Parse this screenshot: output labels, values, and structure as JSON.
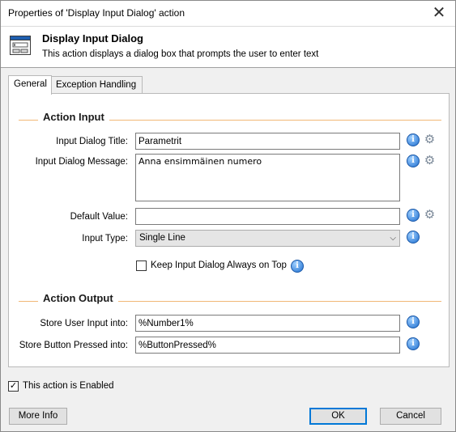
{
  "window": {
    "title": "Properties of 'Display Input Dialog' action",
    "close_glyph": "✕"
  },
  "header": {
    "icon": "dialog-window-icon",
    "title": "Display Input Dialog",
    "description": "This action displays a dialog box that prompts the user to enter text"
  },
  "tabs": [
    {
      "label": "General",
      "active": true
    },
    {
      "label": "Exception Handling",
      "active": false
    }
  ],
  "action_input": {
    "section_title": "Action Input",
    "dialog_title": {
      "label": "Input Dialog Title:",
      "value": "Parametrit"
    },
    "dialog_message": {
      "label": "Input Dialog Message:",
      "value": "Anna ensimmäinen numero"
    },
    "default_value": {
      "label": "Default Value:",
      "value": ""
    },
    "input_type": {
      "label": "Input Type:",
      "value": "Single Line"
    },
    "keep_on_top": {
      "label": "Keep Input Dialog Always on Top",
      "checked": false
    }
  },
  "action_output": {
    "section_title": "Action Output",
    "store_user_input": {
      "label": "Store User Input into:",
      "value": "%Number1%"
    },
    "store_button_pressed": {
      "label": "Store Button Pressed into:",
      "value": "%ButtonPressed%"
    }
  },
  "footer": {
    "enabled": {
      "label": "This action is Enabled",
      "checked": true,
      "check_glyph": "✓"
    },
    "more_info_label": "More Info",
    "ok_label": "OK",
    "cancel_label": "Cancel"
  },
  "icons": {
    "info_glyph": "i",
    "gear_glyph": "⚙",
    "chevron_glyph": "⌵"
  },
  "colors": {
    "section_rule": "#f1b877",
    "default_button_border": "#0078d7"
  }
}
